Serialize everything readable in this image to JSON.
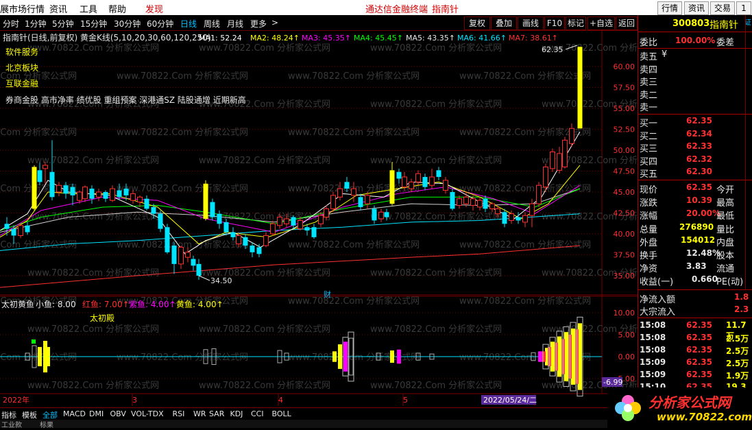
{
  "menu": {
    "items": [
      "展市场行情",
      "资讯",
      "工具",
      "帮助",
      "发现"
    ],
    "center_title": "通达信金融终端",
    "center_stock": "指南针",
    "right_buttons": [
      "行情",
      "资讯",
      "交易",
      "1"
    ]
  },
  "periods": [
    "分时",
    "1分钟",
    "5分钟",
    "15分钟",
    "30分钟",
    "60分钟",
    "日线",
    "周线",
    "月线",
    "更多",
    ">"
  ],
  "active_period": "日线",
  "right_tools": [
    "复权",
    "叠加",
    "画线",
    "F10",
    "标记",
    "+自选",
    "返回"
  ],
  "main_chart": {
    "header_title": "指南针(日线,前复权) 黄金K线(5,10,20,30,60,120,250)",
    "ma": [
      {
        "label": "MA1: 52.24",
        "color": "#ffffff"
      },
      {
        "label": "MA2: 48.24↑",
        "color": "#ffff00"
      },
      {
        "label": "MA3: 45.35↑",
        "color": "#ff00ff"
      },
      {
        "label": "MA4: 45.45↑",
        "color": "#00ff00"
      },
      {
        "label": "MA5: 43.35↑",
        "color": "#e6e6e6"
      },
      {
        "label": "MA6: 41.66↑",
        "color": "#00e5ff"
      },
      {
        "label": "MA7: 38.61↑",
        "color": "#ff3030"
      }
    ],
    "tags": [
      "软件服务",
      "北京板块",
      "互联金融"
    ],
    "concepts": "券商金股 高市净率 绩优股 重组预案 深港通SZ 陆股通增 近期新高",
    "price_ticks": [
      "60.00",
      "57.50",
      "55.00",
      "52.50",
      "50.00",
      "47.50",
      "45.00",
      "42.50",
      "40.00",
      "37.50",
      "35.00"
    ],
    "high_label": "62.35",
    "low_label": "34.50",
    "finance_marker": "财"
  },
  "sub_chart": {
    "header": "太初黄鱼",
    "params": [
      {
        "label": "小鱼: 8.00",
        "color": "#e6e6e6"
      },
      {
        "label": "红鱼: 7.00↑",
        "color": "#ff3030"
      },
      {
        "label": "紫鱼: 4.00↑",
        "color": "#ff00ff"
      },
      {
        "label": "黄鱼: 4.00↑",
        "color": "#ffff00"
      }
    ],
    "caption": "太初殿",
    "ticks": [
      "10.00",
      "5.00",
      "0.00",
      "-5.00"
    ],
    "last_value": "-6.99"
  },
  "date_axis": [
    "2022年",
    "3",
    "4",
    "5"
  ],
  "cursor_date": "2022/05/24/二",
  "bottom_tabs": [
    "指标",
    "模板",
    "全部",
    "MACD",
    "DMI",
    "OBV",
    "VOL-TDX",
    "RSI",
    "WR",
    "SAR",
    "KDJ",
    "CCI",
    "BOLL"
  ],
  "status_left": "工业款",
  "status_mid": "标果",
  "quote": {
    "code": "300803",
    "name": "指南针",
    "corner": "证",
    "weibi_label": "委比",
    "weibi_value": "100.00%",
    "weicha_label": "委差",
    "sells": [
      {
        "label": "卖五",
        "price": "¥"
      },
      {
        "label": "卖四",
        "price": ""
      },
      {
        "label": "卖三",
        "price": ""
      },
      {
        "label": "卖二",
        "price": ""
      },
      {
        "label": "卖一",
        "price": ""
      }
    ],
    "buys": [
      {
        "label": "买一",
        "price": "62.35"
      },
      {
        "label": "买二",
        "price": "62.34"
      },
      {
        "label": "买三",
        "price": "62.33"
      },
      {
        "label": "买四",
        "price": "62.32"
      },
      {
        "label": "买五",
        "price": "62.30"
      }
    ],
    "stats": [
      {
        "l": "现价",
        "v": "62.35",
        "r": "今开"
      },
      {
        "l": "涨跌",
        "v": "10.39",
        "r": "最高"
      },
      {
        "l": "涨幅",
        "v": "20.00%",
        "r": "最低"
      },
      {
        "l": "总量",
        "v": "276890",
        "r": "量比"
      },
      {
        "l": "外盘",
        "v": "154012",
        "r": "内盘"
      },
      {
        "l": "换手",
        "v": "12.48%",
        "r": "股本"
      },
      {
        "l": "净资",
        "v": "3.83",
        "r": "流通"
      },
      {
        "l": "收益(一)",
        "v": "0.660",
        "r": "PE(动)"
      }
    ],
    "flows": [
      {
        "l": "净流入额",
        "v": "1.8"
      },
      {
        "l": "大宗流入",
        "v": "2.3"
      }
    ],
    "ticks": [
      {
        "t": "15:08",
        "p": "62.35",
        "v": "11.7万"
      },
      {
        "t": "15:08",
        "p": "62.35",
        "v": "2.5万"
      },
      {
        "t": "15:08",
        "p": "62.35",
        "v": "2.5万"
      },
      {
        "t": "15:09",
        "p": "62.35",
        "v": "2.5万"
      },
      {
        "t": "15:09",
        "p": "62.35",
        "v": "1.9万"
      },
      {
        "t": "15:10",
        "p": "62.35",
        "v": "19.3万"
      }
    ]
  },
  "logo": {
    "text": "分析家公式网",
    "url": "www.70822.com"
  },
  "watermark": "www.70822.Com 分析家公式网",
  "colors": {
    "up": "#ff3030",
    "down": "#00e5ff",
    "yellow": "#ffff00",
    "magenta": "#ff00ff",
    "grid": "#7a0000"
  }
}
